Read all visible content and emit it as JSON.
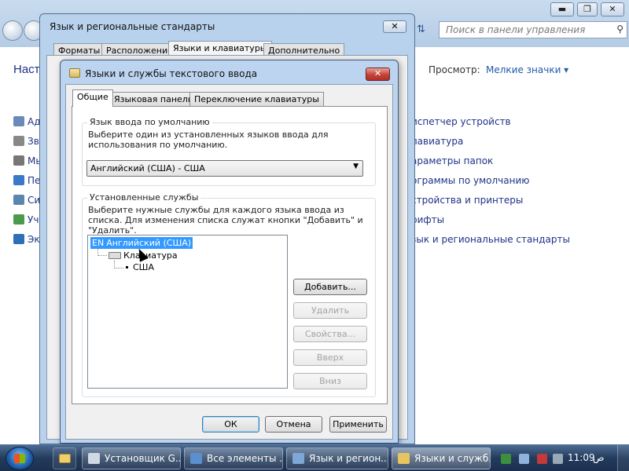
{
  "control_panel": {
    "search_placeholder": "Поиск в панели управления",
    "heading": "Наст",
    "view_label": "Просмотр:",
    "view_value": "Мелкие значки ▾",
    "left_items": [
      "Ад",
      "Зв",
      "Мь",
      "Пе",
      "Си",
      "Уч",
      "Эк"
    ],
    "right_items": [
      "испетчер устройств",
      "лавиатура",
      "араметры папок",
      "ограммы по умолчанию",
      "стройства и принтеры",
      "рифты",
      "зык и региональные стандарты"
    ],
    "window_buttons": {
      "minimize": "▬",
      "maximize": "❐",
      "close": "✕"
    }
  },
  "regional_window": {
    "title": "Язык и региональные стандарты",
    "tabs": [
      "Форматы",
      "Расположение",
      "Языки и клавиатуры",
      "Дополнительно"
    ],
    "close": "✕"
  },
  "dialog": {
    "title": "Языки и службы текстового ввода",
    "close": "✕",
    "tabs": [
      "Общие",
      "Языковая панель",
      "Переключение клавиатуры"
    ],
    "default_lang": {
      "group_label": "Язык ввода по умолчанию",
      "description": "Выберите один из установленных языков ввода для использования по умолчанию.",
      "selected": "Английский (США) - США"
    },
    "services": {
      "group_label": "Установленные службы",
      "description": "Выберите нужные службы для каждого языка ввода из списка. Для изменения списка служат кнопки \"Добавить\" и \"Удалить\".",
      "tree": {
        "lang_code": "EN",
        "lang_name": "Английский (США)",
        "category": "Клавиатура",
        "layout": "США"
      },
      "buttons": {
        "add": "Добавить...",
        "remove": "Удалить",
        "properties": "Свойства...",
        "up": "Вверх",
        "down": "Вниз"
      }
    },
    "footer": {
      "ok": "ОК",
      "cancel": "Отмена",
      "apply": "Применить"
    }
  },
  "taskbar": {
    "items": [
      "Установщик G...",
      "Все элементы ...",
      "Язык и регион...",
      "Языки и служб..."
    ],
    "time": "11:09",
    "locale": "ص"
  }
}
